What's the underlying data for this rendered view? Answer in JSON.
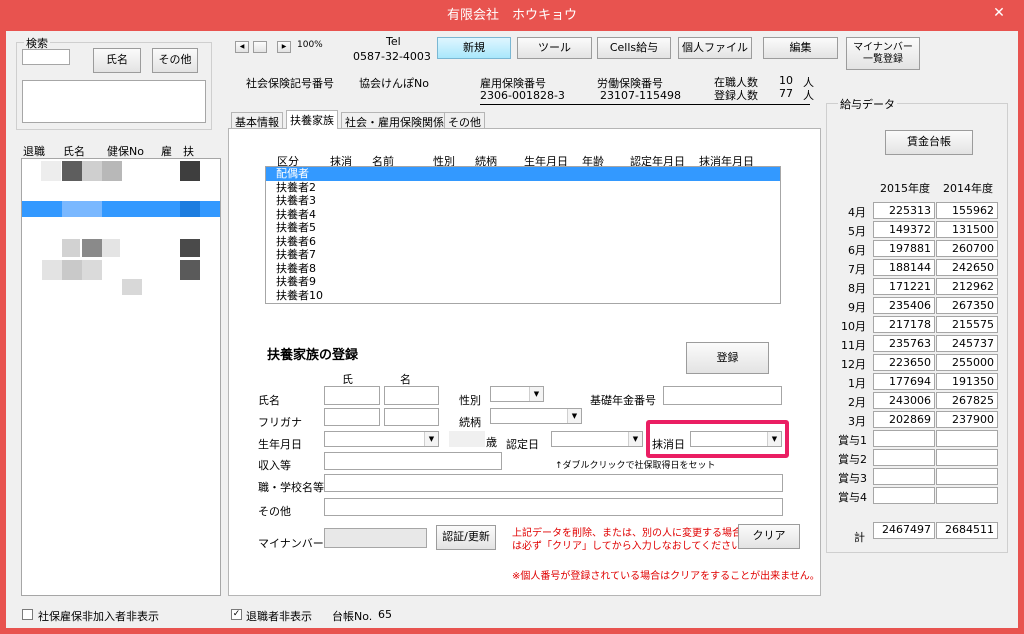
{
  "window": {
    "title": "有限会社　ホウキョウ",
    "close": "✕"
  },
  "search": {
    "group_label": "検索",
    "name_btn": "氏名",
    "other_btn": "その他"
  },
  "left_list": {
    "headers": [
      "退職",
      "氏名",
      "健保No",
      "雇",
      "扶"
    ]
  },
  "nav": {
    "first": "◀",
    "prev": "",
    "next": "▶",
    "zoom": "100%"
  },
  "tel": {
    "label": "Tel",
    "number": "0587-32-4003"
  },
  "toolbar": {
    "new": "新規",
    "tool": "ツール",
    "cells": "Cells給与",
    "file": "個人ファイル",
    "edit": "編集",
    "mynumber": "マイナンバー\n一覧登録"
  },
  "info": {
    "social_label": "社会保険記号番号",
    "kyokai_label": "協会けんぽNo",
    "emp_ins_label": "雇用保険番号",
    "emp_ins_value": "2306-001828-3",
    "labor_ins_label": "労働保険番号",
    "labor_ins_value": "23107-115498",
    "enrolled_label": "在職人数",
    "enrolled_value": "10",
    "enrolled_unit": "人",
    "registered_label": "登録人数",
    "registered_value": "77",
    "registered_unit": "人"
  },
  "tabs": [
    "基本情報",
    "扶養家族",
    "社会・雇用保険関係",
    "その他"
  ],
  "dep_list": {
    "headers": [
      "区分",
      "抹消",
      "名前",
      "性別",
      "続柄",
      "生年月日",
      "年齢",
      "認定年月日",
      "抹消年月日"
    ],
    "rows": [
      "配偶者",
      "扶養者2",
      "扶養者3",
      "扶養者4",
      "扶養者5",
      "扶養者6",
      "扶養者7",
      "扶養者8",
      "扶養者9",
      "扶養者10"
    ]
  },
  "form": {
    "section_title": "扶養家族の登録",
    "register_btn": "登録",
    "sei": "氏",
    "mei": "名",
    "name": "氏名",
    "furigana": "フリガナ",
    "gender": "性別",
    "relation": "続柄",
    "pension": "基礎年金番号",
    "birthdate": "生年月日",
    "age_unit": "歳",
    "cert_date": "認定日",
    "delete_date": "抹消日",
    "income": "収入等",
    "hint": "↑ダブルクリックで社保取得日をセット",
    "job_school": "職・学校名等",
    "other": "その他",
    "mynumber": "マイナンバー",
    "auth_btn": "認証/更新",
    "warning1": "上記データを削除、または、別の人に変更する場合",
    "warning2": "は必ず「クリア」してから入力しなおしてください⇒⇒",
    "clear_btn": "クリア",
    "note": "※個人番号が登録されている場合はクリアをすることが出来ません。"
  },
  "salary": {
    "group_label": "給与データ",
    "ledger_btn": "賃金台帳",
    "years": [
      "2015年度",
      "2014年度"
    ],
    "rows": [
      {
        "m": "4月",
        "a": "225313",
        "b": "155962"
      },
      {
        "m": "5月",
        "a": "149372",
        "b": "131500"
      },
      {
        "m": "6月",
        "a": "197881",
        "b": "260700"
      },
      {
        "m": "7月",
        "a": "188144",
        "b": "242650"
      },
      {
        "m": "8月",
        "a": "171221",
        "b": "212962"
      },
      {
        "m": "9月",
        "a": "235406",
        "b": "267350"
      },
      {
        "m": "10月",
        "a": "217178",
        "b": "215575"
      },
      {
        "m": "11月",
        "a": "235763",
        "b": "245737"
      },
      {
        "m": "12月",
        "a": "223650",
        "b": "255000"
      },
      {
        "m": "1月",
        "a": "177694",
        "b": "191350"
      },
      {
        "m": "2月",
        "a": "243006",
        "b": "267825"
      },
      {
        "m": "3月",
        "a": "202869",
        "b": "237900"
      },
      {
        "m": "賞与1",
        "a": "",
        "b": ""
      },
      {
        "m": "賞与2",
        "a": "",
        "b": ""
      },
      {
        "m": "賞与3",
        "a": "",
        "b": ""
      },
      {
        "m": "賞与4",
        "a": "",
        "b": ""
      }
    ],
    "total_label": "計",
    "total_a": "2467497",
    "total_b": "2684511"
  },
  "footer": {
    "hide_unenrolled": "社保雇保非加入者非表示",
    "hide_retired": "退職者非表示",
    "ledger_no_label": "台帳No.",
    "ledger_no": "65",
    "hide_retired_checked": "✓"
  },
  "colors": {
    "border": "#e8534f",
    "highlight": "#ea1e63",
    "selection": "#3399ff",
    "warning": "#e00000"
  }
}
